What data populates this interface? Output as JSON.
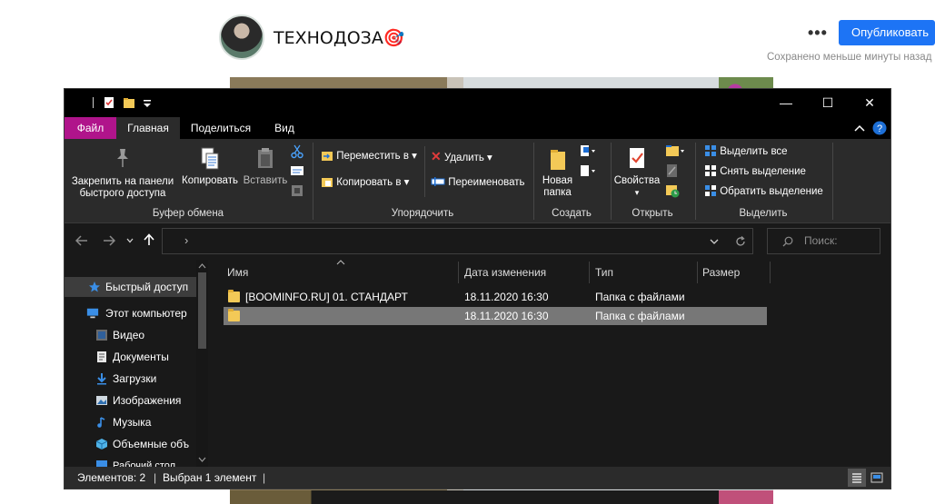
{
  "editor": {
    "channel_name": "ТЕХНОДОЗА🎯",
    "more_label": "•••",
    "publish_label": "Опубликовать",
    "saved_status": "Сохранено меньше минуты назад"
  },
  "window": {
    "controls": {
      "minimize": "—",
      "maximize": "☐",
      "close": "✕"
    },
    "tabs": [
      {
        "label": "Файл",
        "active": false,
        "color": "#b0148b"
      },
      {
        "label": "Главная",
        "active": true
      },
      {
        "label": "Поделиться",
        "active": false
      },
      {
        "label": "Вид",
        "active": false
      }
    ],
    "ribbon": {
      "clipboard": {
        "pin_label_1": "Закрепить на панели",
        "pin_label_2": "быстрого доступа",
        "copy_label": "Копировать",
        "paste_label": "Вставить",
        "group_label": "Буфер обмена"
      },
      "organize": {
        "move_label": "Переместить в",
        "copy_to_label": "Копировать в",
        "delete_label": "Удалить",
        "rename_label": "Переименовать",
        "group_label": "Упорядочить"
      },
      "create": {
        "new_folder_1": "Новая",
        "new_folder_2": "папка",
        "group_label": "Создать"
      },
      "open": {
        "properties_label": "Свойства",
        "group_label": "Открыть"
      },
      "select": {
        "select_all": "Выделить все",
        "select_none": "Снять выделение",
        "invert": "Обратить выделение",
        "group_label": "Выделить"
      }
    },
    "nav": {
      "address_value": "›",
      "search_placeholder": "Поиск:"
    },
    "sidebar": {
      "items": [
        {
          "label": "Быстрый доступ",
          "icon": "star-icon",
          "selected": true
        },
        {
          "label": "Этот компьютер",
          "icon": "computer-icon"
        },
        {
          "label": "Видео",
          "icon": "video-icon"
        },
        {
          "label": "Документы",
          "icon": "documents-icon"
        },
        {
          "label": "Загрузки",
          "icon": "downloads-icon"
        },
        {
          "label": "Изображения",
          "icon": "pictures-icon"
        },
        {
          "label": "Музыка",
          "icon": "music-icon"
        },
        {
          "label": "Объемные объ",
          "icon": "3d-objects-icon"
        },
        {
          "label": "Рабочий стол",
          "icon": "desktop-icon"
        }
      ]
    },
    "columns": {
      "name": "Имя",
      "date": "Дата изменения",
      "type": "Тип",
      "size": "Размер"
    },
    "files": [
      {
        "name": "[BOOMINFO.RU] 01. СТАНДАРТ",
        "date": "18.11.2020 16:30",
        "type": "Папка с файлами",
        "selected": false
      },
      {
        "name": "",
        "date": "18.11.2020 16:30",
        "type": "Папка с файлами",
        "selected": true
      }
    ],
    "status": {
      "items_count": "Элементов: 2",
      "selected_count": "Выбран 1 элемент"
    }
  }
}
